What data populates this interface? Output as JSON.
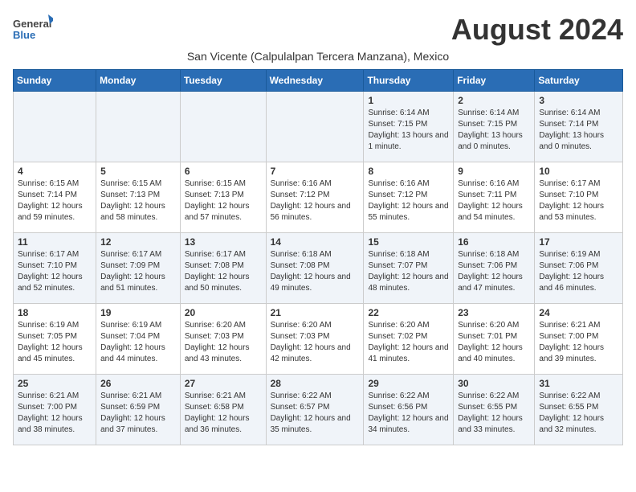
{
  "logo": {
    "general": "General",
    "blue": "Blue"
  },
  "title": "August 2024",
  "subtitle": "San Vicente (Calpulalpan Tercera Manzana), Mexico",
  "days_of_week": [
    "Sunday",
    "Monday",
    "Tuesday",
    "Wednesday",
    "Thursday",
    "Friday",
    "Saturday"
  ],
  "weeks": [
    [
      {
        "day": "",
        "info": ""
      },
      {
        "day": "",
        "info": ""
      },
      {
        "day": "",
        "info": ""
      },
      {
        "day": "",
        "info": ""
      },
      {
        "day": "1",
        "info": "Sunrise: 6:14 AM\nSunset: 7:15 PM\nDaylight: 13 hours\nand 1 minute."
      },
      {
        "day": "2",
        "info": "Sunrise: 6:14 AM\nSunset: 7:15 PM\nDaylight: 13 hours\nand 0 minutes."
      },
      {
        "day": "3",
        "info": "Sunrise: 6:14 AM\nSunset: 7:14 PM\nDaylight: 13 hours\nand 0 minutes."
      }
    ],
    [
      {
        "day": "4",
        "info": "Sunrise: 6:15 AM\nSunset: 7:14 PM\nDaylight: 12 hours\nand 59 minutes."
      },
      {
        "day": "5",
        "info": "Sunrise: 6:15 AM\nSunset: 7:13 PM\nDaylight: 12 hours\nand 58 minutes."
      },
      {
        "day": "6",
        "info": "Sunrise: 6:15 AM\nSunset: 7:13 PM\nDaylight: 12 hours\nand 57 minutes."
      },
      {
        "day": "7",
        "info": "Sunrise: 6:16 AM\nSunset: 7:12 PM\nDaylight: 12 hours\nand 56 minutes."
      },
      {
        "day": "8",
        "info": "Sunrise: 6:16 AM\nSunset: 7:12 PM\nDaylight: 12 hours\nand 55 minutes."
      },
      {
        "day": "9",
        "info": "Sunrise: 6:16 AM\nSunset: 7:11 PM\nDaylight: 12 hours\nand 54 minutes."
      },
      {
        "day": "10",
        "info": "Sunrise: 6:17 AM\nSunset: 7:10 PM\nDaylight: 12 hours\nand 53 minutes."
      }
    ],
    [
      {
        "day": "11",
        "info": "Sunrise: 6:17 AM\nSunset: 7:10 PM\nDaylight: 12 hours\nand 52 minutes."
      },
      {
        "day": "12",
        "info": "Sunrise: 6:17 AM\nSunset: 7:09 PM\nDaylight: 12 hours\nand 51 minutes."
      },
      {
        "day": "13",
        "info": "Sunrise: 6:17 AM\nSunset: 7:08 PM\nDaylight: 12 hours\nand 50 minutes."
      },
      {
        "day": "14",
        "info": "Sunrise: 6:18 AM\nSunset: 7:08 PM\nDaylight: 12 hours\nand 49 minutes."
      },
      {
        "day": "15",
        "info": "Sunrise: 6:18 AM\nSunset: 7:07 PM\nDaylight: 12 hours\nand 48 minutes."
      },
      {
        "day": "16",
        "info": "Sunrise: 6:18 AM\nSunset: 7:06 PM\nDaylight: 12 hours\nand 47 minutes."
      },
      {
        "day": "17",
        "info": "Sunrise: 6:19 AM\nSunset: 7:06 PM\nDaylight: 12 hours\nand 46 minutes."
      }
    ],
    [
      {
        "day": "18",
        "info": "Sunrise: 6:19 AM\nSunset: 7:05 PM\nDaylight: 12 hours\nand 45 minutes."
      },
      {
        "day": "19",
        "info": "Sunrise: 6:19 AM\nSunset: 7:04 PM\nDaylight: 12 hours\nand 44 minutes."
      },
      {
        "day": "20",
        "info": "Sunrise: 6:20 AM\nSunset: 7:03 PM\nDaylight: 12 hours\nand 43 minutes."
      },
      {
        "day": "21",
        "info": "Sunrise: 6:20 AM\nSunset: 7:03 PM\nDaylight: 12 hours\nand 42 minutes."
      },
      {
        "day": "22",
        "info": "Sunrise: 6:20 AM\nSunset: 7:02 PM\nDaylight: 12 hours\nand 41 minutes."
      },
      {
        "day": "23",
        "info": "Sunrise: 6:20 AM\nSunset: 7:01 PM\nDaylight: 12 hours\nand 40 minutes."
      },
      {
        "day": "24",
        "info": "Sunrise: 6:21 AM\nSunset: 7:00 PM\nDaylight: 12 hours\nand 39 minutes."
      }
    ],
    [
      {
        "day": "25",
        "info": "Sunrise: 6:21 AM\nSunset: 7:00 PM\nDaylight: 12 hours\nand 38 minutes."
      },
      {
        "day": "26",
        "info": "Sunrise: 6:21 AM\nSunset: 6:59 PM\nDaylight: 12 hours\nand 37 minutes."
      },
      {
        "day": "27",
        "info": "Sunrise: 6:21 AM\nSunset: 6:58 PM\nDaylight: 12 hours\nand 36 minutes."
      },
      {
        "day": "28",
        "info": "Sunrise: 6:22 AM\nSunset: 6:57 PM\nDaylight: 12 hours\nand 35 minutes."
      },
      {
        "day": "29",
        "info": "Sunrise: 6:22 AM\nSunset: 6:56 PM\nDaylight: 12 hours\nand 34 minutes."
      },
      {
        "day": "30",
        "info": "Sunrise: 6:22 AM\nSunset: 6:55 PM\nDaylight: 12 hours\nand 33 minutes."
      },
      {
        "day": "31",
        "info": "Sunrise: 6:22 AM\nSunset: 6:55 PM\nDaylight: 12 hours\nand 32 minutes."
      }
    ]
  ]
}
